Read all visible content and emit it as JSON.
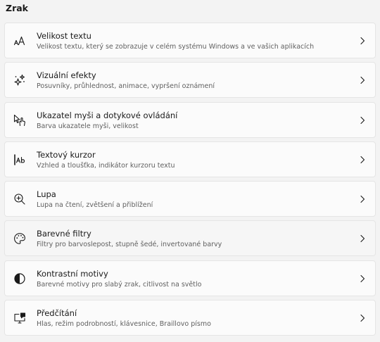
{
  "section": {
    "title": "Zrak"
  },
  "items": [
    {
      "icon": "text-size-icon",
      "title": "Velikost textu",
      "subtitle": "Velikost textu, který se zobrazuje v celém systému Windows a ve vašich aplikacích"
    },
    {
      "icon": "sparkle-icon",
      "title": "Vizuální efekty",
      "subtitle": "Posuvníky, průhlednost, animace, vypršení oznámení"
    },
    {
      "icon": "mouse-pointer-icon",
      "title": "Ukazatel myši a dotykové ovládání",
      "subtitle": "Barva ukazatele myši, velikost"
    },
    {
      "icon": "text-cursor-icon",
      "title": "Textový kurzor",
      "subtitle": "Vzhled a tloušťka, indikátor kurzoru textu"
    },
    {
      "icon": "magnifier-icon",
      "title": "Lupa",
      "subtitle": "Lupa na čtení, zvětšení a přiblížení"
    },
    {
      "icon": "palette-icon",
      "title": "Barevné filtry",
      "subtitle": "Filtry pro barvoslepost, stupně šedé, invertované barvy"
    },
    {
      "icon": "contrast-icon",
      "title": "Kontrastní motivy",
      "subtitle": "Barevné motivy pro slabý zrak, citlivost na světlo"
    },
    {
      "icon": "narrator-icon",
      "title": "Předčítání",
      "subtitle": "Hlas, režim podrobností, klávesnice, Braillovo písmo"
    }
  ],
  "colors": {
    "background": "#f3f3f3",
    "card": "#fbfbfb",
    "border": "#e5e5e5",
    "text": "#1a1a1a",
    "secondary_text": "#5f5f5f"
  }
}
